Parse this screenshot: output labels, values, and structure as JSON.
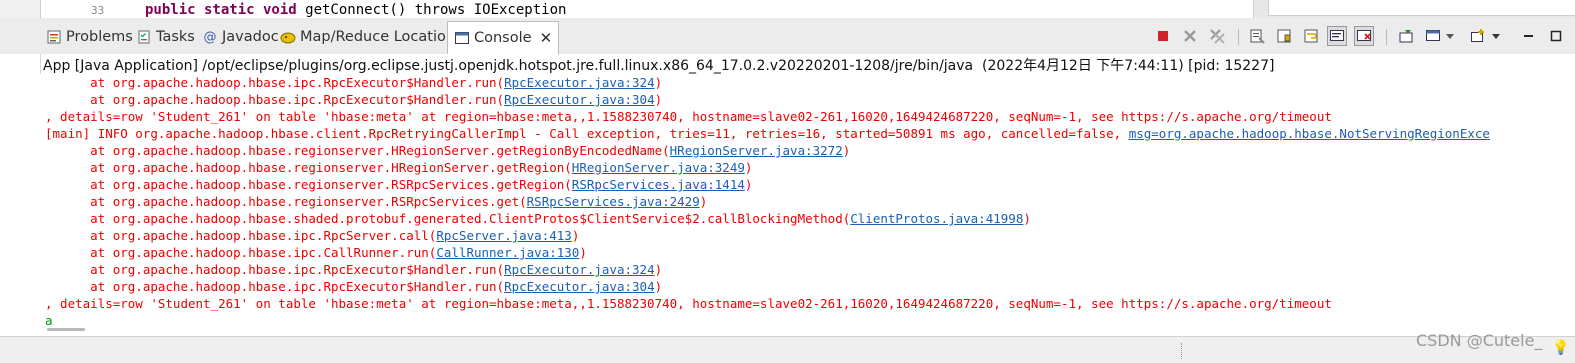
{
  "editor": {
    "line_number": "33",
    "code_keywords": "public static void",
    "code_rest": " getConnect() throws IOException"
  },
  "tabs": [
    {
      "label": "Problems",
      "icon": "problems-icon"
    },
    {
      "label": "Tasks",
      "icon": "tasks-icon"
    },
    {
      "label": "Javadoc",
      "icon": "javadoc-icon"
    },
    {
      "label": "Map/Reduce Locations",
      "icon": "map-reduce-icon"
    },
    {
      "label": "Console",
      "icon": "console-icon",
      "active": true
    }
  ],
  "toolbar": [
    "terminate-icon",
    "remove-launch-icon",
    "remove-all-terminated-icon",
    "clear-console-icon",
    "scroll-lock-icon",
    "word-wrap-icon",
    "show-on-stdout-icon",
    "show-on-stderr-icon",
    "pin-console-icon",
    "display-console-icon",
    "open-console-icon",
    "view-menu-icon",
    "minimize-icon",
    "maximize-icon"
  ],
  "launch_info": "App [Java Application] /opt/eclipse/plugins/org.eclipse.justj.openjdk.hotspot.jre.full.linux.x86_64_17.0.2.v20220201-1208/jre/bin/java  (2022年4月12日 下午7:44:11) [pid: 15227]",
  "console_lines": [
    {
      "pre": "\tat org.apache.hadoop.hbase.ipc.RpcExecutor$Handler.run(",
      "link": "RpcExecutor.java:324",
      "post": ")"
    },
    {
      "pre": "\tat org.apache.hadoop.hbase.ipc.RpcExecutor$Handler.run(",
      "link": "RpcExecutor.java:304",
      "post": ")"
    },
    {
      "pre": ", details=row 'Student_261' on table 'hbase:meta' at region=hbase:meta,,1.1588230740, hostname=slave02-261,16020,1649424687220, seqNum=-1, see https://s.apache.org/timeout",
      "link": "",
      "post": ""
    },
    {
      "pre": "[main] INFO org.apache.hadoop.hbase.client.RpcRetryingCallerImpl - Call exception, tries=11, retries=16, started=50891 ms ago, cancelled=false, ",
      "link": "msg=org.apache.hadoop.hbase.NotServingRegionExce",
      "post": ""
    },
    {
      "pre": "\tat org.apache.hadoop.hbase.regionserver.HRegionServer.getRegionByEncodedName(",
      "link": "HRegionServer.java:3272",
      "post": ")"
    },
    {
      "pre": "\tat org.apache.hadoop.hbase.regionserver.HRegionServer.getRegion(",
      "link": "HRegionServer.java:3249",
      "post": ")"
    },
    {
      "pre": "\tat org.apache.hadoop.hbase.regionserver.RSRpcServices.getRegion(",
      "link": "RSRpcServices.java:1414",
      "post": ")"
    },
    {
      "pre": "\tat org.apache.hadoop.hbase.regionserver.RSRpcServices.get(",
      "link": "RSRpcServices.java:2429",
      "post": ")"
    },
    {
      "pre": "\tat org.apache.hadoop.hbase.shaded.protobuf.generated.ClientProtos$ClientService$2.callBlockingMethod(",
      "link": "ClientProtos.java:41998",
      "post": ")"
    },
    {
      "pre": "\tat org.apache.hadoop.hbase.ipc.RpcServer.call(",
      "link": "RpcServer.java:413",
      "post": ")"
    },
    {
      "pre": "\tat org.apache.hadoop.hbase.ipc.CallRunner.run(",
      "link": "CallRunner.java:130",
      "post": ")"
    },
    {
      "pre": "\tat org.apache.hadoop.hbase.ipc.RpcExecutor$Handler.run(",
      "link": "RpcExecutor.java:324",
      "post": ")"
    },
    {
      "pre": "\tat org.apache.hadoop.hbase.ipc.RpcExecutor$Handler.run(",
      "link": "RpcExecutor.java:304",
      "post": ")"
    },
    {
      "pre": ", details=row 'Student_261' on table 'hbase:meta' at region=hbase:meta,,1.1588230740, hostname=slave02-261,16020,1649424687220, seqNum=-1, see https://s.apache.org/timeout",
      "link": "",
      "post": ""
    }
  ],
  "input_line": "a",
  "watermark": "CSDN @Cutele_",
  "colors": {
    "error": "#ee0000",
    "link": "#1a5fb4",
    "input": "#009900"
  }
}
